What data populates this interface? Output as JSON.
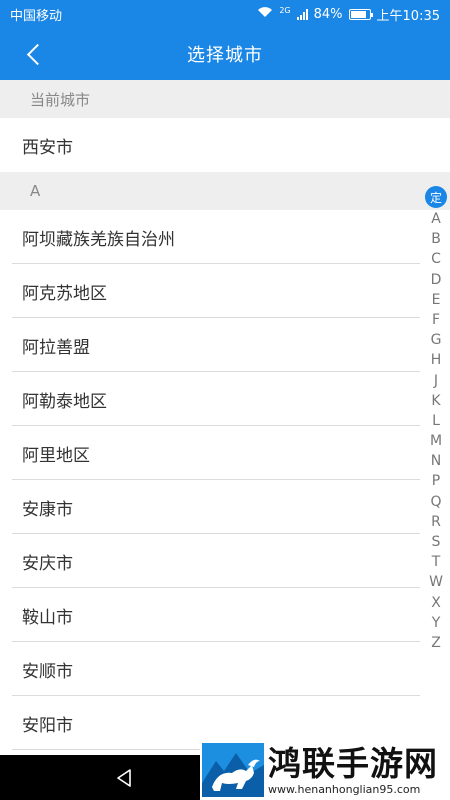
{
  "status_bar": {
    "carrier": "中国移动",
    "network": "2G",
    "battery": "84%",
    "battery_level": 0.84,
    "time": "上午10:35"
  },
  "app_bar": {
    "title": "选择城市"
  },
  "current_city": {
    "header": "当前城市",
    "city": "西安市"
  },
  "section": {
    "letter": "A",
    "cities": [
      "阿坝藏族羌族自治州",
      "阿克苏地区",
      "阿拉善盟",
      "阿勒泰地区",
      "阿里地区",
      "安康市",
      "安庆市",
      "鞍山市",
      "安顺市",
      "安阳市"
    ]
  },
  "index_bar": {
    "locate_label": "定",
    "letters": [
      "A",
      "B",
      "C",
      "D",
      "E",
      "F",
      "G",
      "H",
      "J",
      "K",
      "L",
      "M",
      "N",
      "P",
      "Q",
      "R",
      "S",
      "T",
      "W",
      "X",
      "Y",
      "Z"
    ]
  },
  "watermark": {
    "title": "鸿联手游网",
    "url": "www.henanhonglian95.com"
  },
  "colors": {
    "primary": "#1a86e6",
    "section_bg": "#eeeeee",
    "divider": "#dcdcdc"
  }
}
